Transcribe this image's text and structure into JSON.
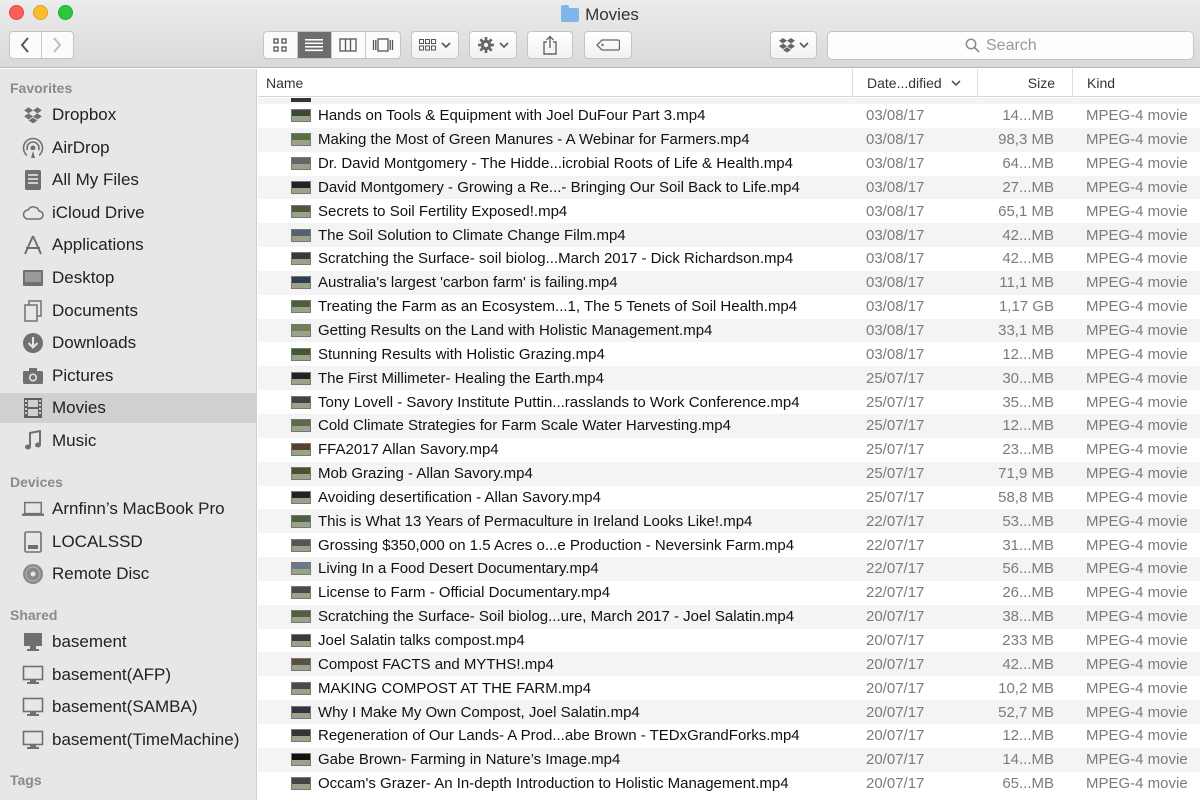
{
  "window": {
    "title": "Movies"
  },
  "toolbar": {
    "search_placeholder": "Search"
  },
  "sidebar": {
    "favorites_heading": "Favorites",
    "favorites": [
      {
        "label": "Dropbox",
        "icon": "dropbox-icon"
      },
      {
        "label": "AirDrop",
        "icon": "airdrop-icon"
      },
      {
        "label": "All My Files",
        "icon": "all-files-icon"
      },
      {
        "label": "iCloud Drive",
        "icon": "cloud-icon"
      },
      {
        "label": "Applications",
        "icon": "applications-icon"
      },
      {
        "label": "Desktop",
        "icon": "desktop-icon"
      },
      {
        "label": "Documents",
        "icon": "documents-icon"
      },
      {
        "label": "Downloads",
        "icon": "downloads-icon"
      },
      {
        "label": "Pictures",
        "icon": "camera-icon"
      },
      {
        "label": "Movies",
        "icon": "film-icon",
        "selected": true
      },
      {
        "label": "Music",
        "icon": "music-note-icon"
      }
    ],
    "devices_heading": "Devices",
    "devices": [
      {
        "label": "Arnfinn’s MacBook Pro",
        "icon": "laptop-icon"
      },
      {
        "label": "LOCALSSD",
        "icon": "disk-icon"
      },
      {
        "label": "Remote Disc",
        "icon": "optical-disc-icon"
      }
    ],
    "shared_heading": "Shared",
    "shared": [
      {
        "label": "basement",
        "icon": "computer-icon"
      },
      {
        "label": "basement(AFP)",
        "icon": "monitor-icon"
      },
      {
        "label": "basement(SAMBA)",
        "icon": "monitor-icon"
      },
      {
        "label": "basement(TimeMachine)",
        "icon": "monitor-icon"
      }
    ],
    "tags_heading": "Tags"
  },
  "columns": {
    "name": "Name",
    "date": "Date...dified",
    "size": "Size",
    "kind": "Kind"
  },
  "files": [
    {
      "name": "Hands on Tools & Equipment with Joel DuFour Part 3.mp4",
      "date": "03/08/17",
      "size": "14...MB",
      "kind": "MPEG-4 movie"
    },
    {
      "name": "Making the Most of Green Manures - A Webinar for Farmers.mp4",
      "date": "03/08/17",
      "size": "98,3 MB",
      "kind": "MPEG-4 movie"
    },
    {
      "name": "Dr. David Montgomery - The Hidde...icrobial Roots of Life & Health.mp4",
      "date": "03/08/17",
      "size": "64...MB",
      "kind": "MPEG-4 movie"
    },
    {
      "name": "David Montgomery - Growing a Re...- Bringing Our Soil Back to Life.mp4",
      "date": "03/08/17",
      "size": "27...MB",
      "kind": "MPEG-4 movie"
    },
    {
      "name": "Secrets to Soil Fertility Exposed!.mp4",
      "date": "03/08/17",
      "size": "65,1 MB",
      "kind": "MPEG-4 movie"
    },
    {
      "name": "The Soil Solution to Climate Change Film.mp4",
      "date": "03/08/17",
      "size": "42...MB",
      "kind": "MPEG-4 movie"
    },
    {
      "name": "Scratching the Surface- soil biolog...March 2017 - Dick Richardson.mp4",
      "date": "03/08/17",
      "size": "42...MB",
      "kind": "MPEG-4 movie"
    },
    {
      "name": "Australia's largest 'carbon farm' is failing.mp4",
      "date": "03/08/17",
      "size": "11,1 MB",
      "kind": "MPEG-4 movie"
    },
    {
      "name": "Treating the Farm as an Ecosystem...1, The 5 Tenets of Soil Health.mp4",
      "date": "03/08/17",
      "size": "1,17 GB",
      "kind": "MPEG-4 movie"
    },
    {
      "name": "Getting Results on the Land with Holistic Management.mp4",
      "date": "03/08/17",
      "size": "33,1 MB",
      "kind": "MPEG-4 movie"
    },
    {
      "name": "Stunning Results with Holistic Grazing.mp4",
      "date": "03/08/17",
      "size": "12...MB",
      "kind": "MPEG-4 movie"
    },
    {
      "name": "The First Millimeter- Healing the Earth.mp4",
      "date": "25/07/17",
      "size": "30...MB",
      "kind": "MPEG-4 movie"
    },
    {
      "name": "Tony Lovell - Savory Institute Puttin...rasslands to Work Conference.mp4",
      "date": "25/07/17",
      "size": "35...MB",
      "kind": "MPEG-4 movie"
    },
    {
      "name": "Cold Climate Strategies for Farm Scale Water Harvesting.mp4",
      "date": "25/07/17",
      "size": "12...MB",
      "kind": "MPEG-4 movie"
    },
    {
      "name": "FFA2017 Allan Savory.mp4",
      "date": "25/07/17",
      "size": "23...MB",
      "kind": "MPEG-4 movie"
    },
    {
      "name": "Mob Grazing - Allan Savory.mp4",
      "date": "25/07/17",
      "size": "71,9 MB",
      "kind": "MPEG-4 movie"
    },
    {
      "name": "Avoiding desertification - Allan Savory.mp4",
      "date": "25/07/17",
      "size": "58,8 MB",
      "kind": "MPEG-4 movie"
    },
    {
      "name": "This is What 13 Years of Permaculture in Ireland Looks Like!.mp4",
      "date": "22/07/17",
      "size": "53...MB",
      "kind": "MPEG-4 movie"
    },
    {
      "name": "Grossing $350,000 on 1.5 Acres o...e Production - Neversink Farm.mp4",
      "date": "22/07/17",
      "size": "31...MB",
      "kind": "MPEG-4 movie"
    },
    {
      "name": "Living In a Food Desert Documentary.mp4",
      "date": "22/07/17",
      "size": "56...MB",
      "kind": "MPEG-4 movie"
    },
    {
      "name": "License to Farm - Official Documentary.mp4",
      "date": "22/07/17",
      "size": "26...MB",
      "kind": "MPEG-4 movie"
    },
    {
      "name": "Scratching the Surface- Soil biolog...ure, March 2017 - Joel Salatin.mp4",
      "date": "20/07/17",
      "size": "38...MB",
      "kind": "MPEG-4 movie"
    },
    {
      "name": "Joel Salatin talks compost.mp4",
      "date": "20/07/17",
      "size": "233 MB",
      "kind": "MPEG-4 movie"
    },
    {
      "name": "Compost FACTS and MYTHS!.mp4",
      "date": "20/07/17",
      "size": "42...MB",
      "kind": "MPEG-4 movie"
    },
    {
      "name": "MAKING COMPOST AT THE FARM.mp4",
      "date": "20/07/17",
      "size": "10,2 MB",
      "kind": "MPEG-4 movie"
    },
    {
      "name": "Why I Make My Own Compost, Joel Salatin.mp4",
      "date": "20/07/17",
      "size": "52,7 MB",
      "kind": "MPEG-4 movie"
    },
    {
      "name": "Regeneration of Our Lands- A Prod...abe Brown - TEDxGrandForks.mp4",
      "date": "20/07/17",
      "size": "12...MB",
      "kind": "MPEG-4 movie"
    },
    {
      "name": "Gabe Brown- Farming in Nature’s Image.mp4",
      "date": "20/07/17",
      "size": "14...MB",
      "kind": "MPEG-4 movie"
    },
    {
      "name": "Occam's Grazer- An In-depth Introduction to Holistic Management.mp4",
      "date": "20/07/17",
      "size": "65...MB",
      "kind": "MPEG-4 movie"
    }
  ],
  "thumb_colors": [
    "#3c4a33",
    "#5a7040",
    "#666",
    "#222",
    "#4d5a3a",
    "#556070",
    "#3a3a3a",
    "#2e3e50",
    "#4a5e3a",
    "#6e7f58",
    "#3f5a2f",
    "#222",
    "#444",
    "#5a6a4a",
    "#5a4030",
    "#4a5030",
    "#222",
    "#4a6040",
    "#555",
    "#6a7a8a",
    "#4a4a4a",
    "#506040",
    "#3a3a3a",
    "#5a5040",
    "#4a4a4a",
    "#3a3040",
    "#333",
    "#111",
    "#444"
  ]
}
